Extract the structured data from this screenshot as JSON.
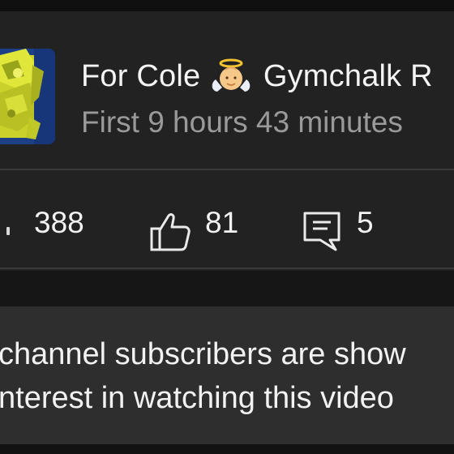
{
  "video": {
    "title_part1": "For Cole",
    "title_part2": "Gymchalk R",
    "subtitle": "First 9 hours 43 minutes",
    "title_emoji_icon": "baby-angel-emoji-icon"
  },
  "stats": {
    "views": "388",
    "likes": "81",
    "comments": "5",
    "icons": {
      "views": "views-icon",
      "likes": "thumbs-up-icon",
      "comments": "comment-icon"
    }
  },
  "info_banner": {
    "line1": "channel subscribers are show",
    "line2": "nterest in watching this video"
  },
  "colors": {
    "background": "#161616",
    "card": "#222222",
    "banner": "#2e2e2e",
    "primary_text": "#f4f4f4",
    "secondary_text": "#9a9a9a",
    "thumbnail_accent": "#d6dc2a"
  }
}
